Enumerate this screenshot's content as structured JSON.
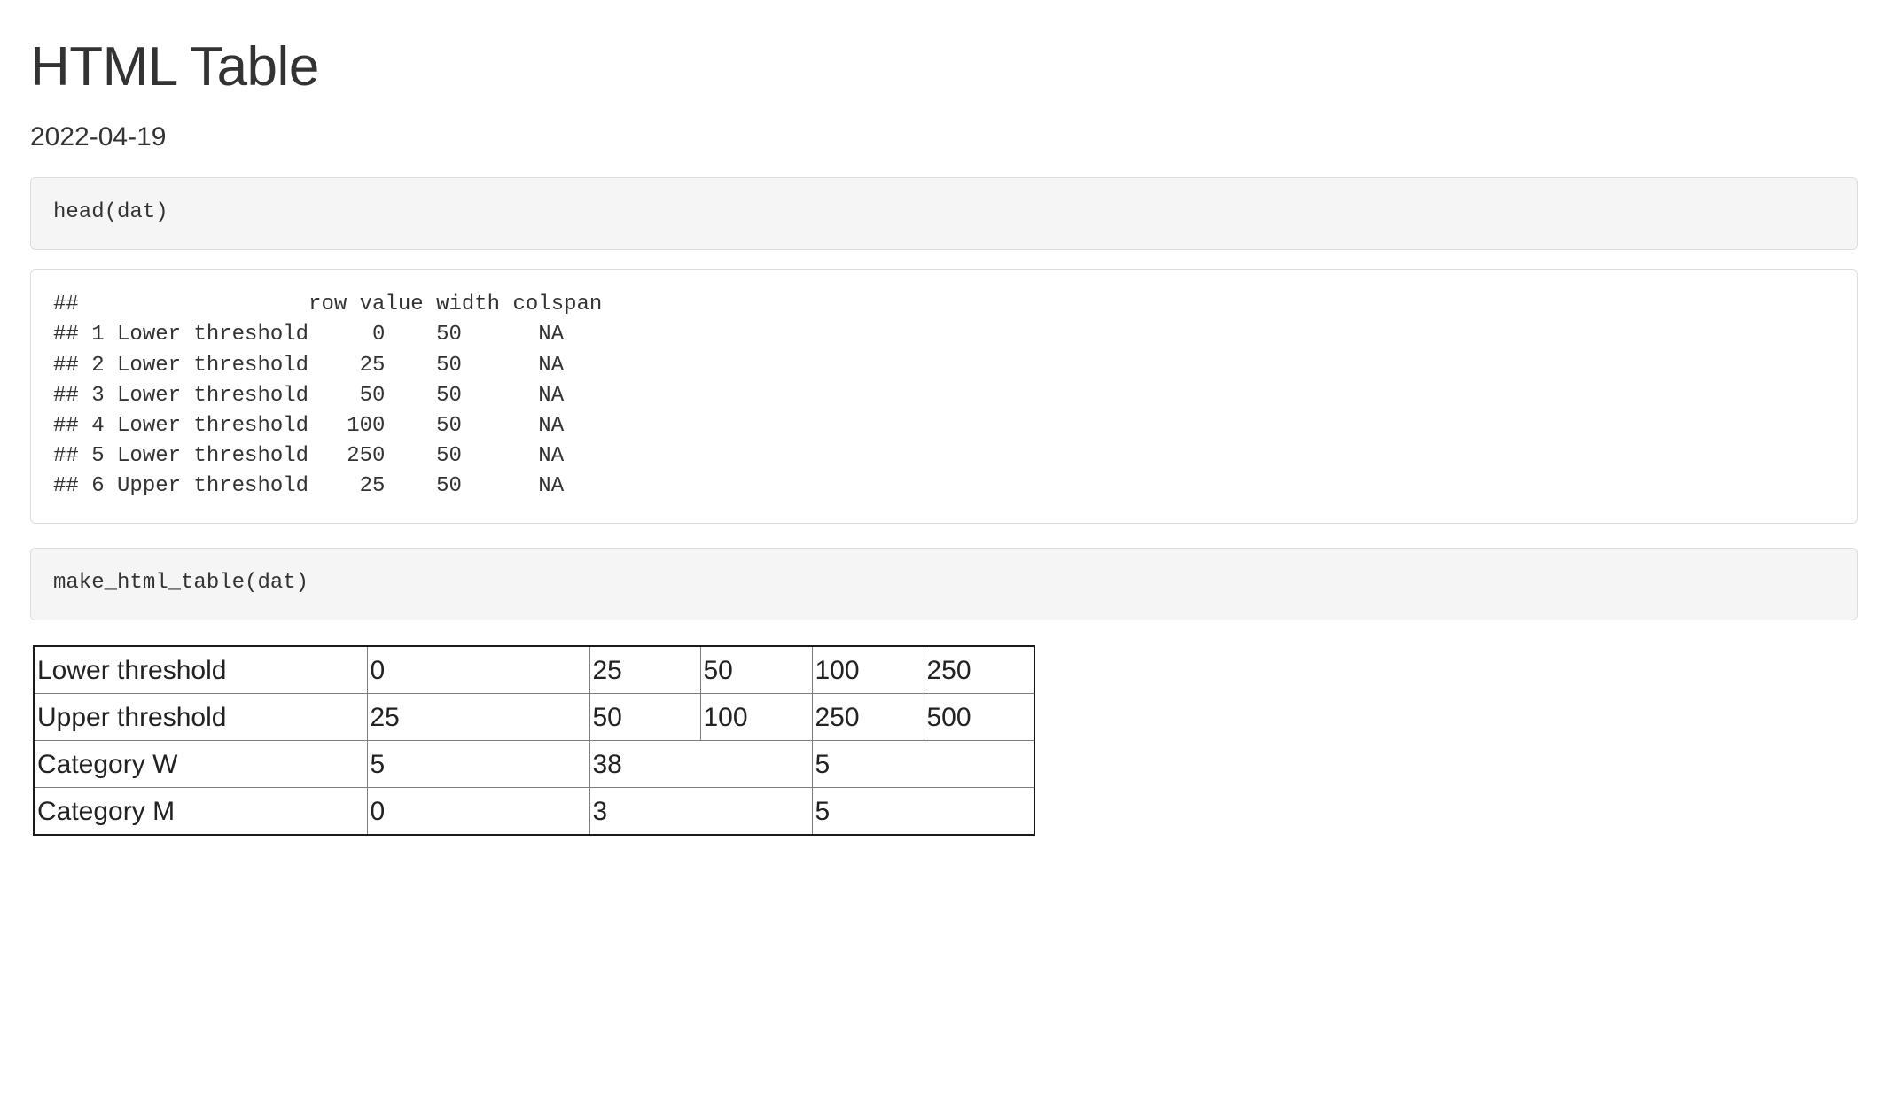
{
  "document": {
    "title": "HTML Table",
    "date": "2022-04-19"
  },
  "chunks": [
    {
      "kind": "source",
      "code": "head(dat)"
    },
    {
      "kind": "output",
      "text": "##                  row value width colspan\n## 1 Lower threshold     0    50      NA\n## 2 Lower threshold    25    50      NA\n## 3 Lower threshold    50    50      NA\n## 4 Lower threshold   100    50      NA\n## 5 Lower threshold   250    50      NA\n## 6 Upper threshold    25    50      NA"
    },
    {
      "kind": "source",
      "code": "make_html_table(dat)"
    }
  ],
  "source_chunk_1": "head(dat)",
  "output_chunk_1": "##                  row value width colspan\n## 1 Lower threshold     0    50      NA\n## 2 Lower threshold    25    50      NA\n## 3 Lower threshold    50    50      NA\n## 4 Lower threshold   100    50      NA\n## 5 Lower threshold   250    50      NA\n## 6 Upper threshold    25    50      NA",
  "source_chunk_2": "make_html_table(dat)",
  "dataframe": {
    "columns": [
      "",
      "row",
      "value",
      "width",
      "colspan"
    ],
    "rows": [
      [
        "1",
        "Lower threshold",
        "0",
        "50",
        "NA"
      ],
      [
        "2",
        "Lower threshold",
        "25",
        "50",
        "NA"
      ],
      [
        "3",
        "Lower threshold",
        "50",
        "50",
        "NA"
      ],
      [
        "4",
        "Lower threshold",
        "100",
        "50",
        "NA"
      ],
      [
        "5",
        "Lower threshold",
        "250",
        "50",
        "NA"
      ],
      [
        "6",
        "Upper threshold",
        "25",
        "50",
        "NA"
      ]
    ]
  },
  "rendered_table": {
    "rows": [
      {
        "label": "Lower threshold",
        "cells": [
          {
            "value": "0",
            "colspan": 1
          },
          {
            "value": "25",
            "colspan": 1
          },
          {
            "value": "50",
            "colspan": 1
          },
          {
            "value": "100",
            "colspan": 1
          },
          {
            "value": "250",
            "colspan": 1
          }
        ]
      },
      {
        "label": "Upper threshold",
        "cells": [
          {
            "value": "25",
            "colspan": 1
          },
          {
            "value": "50",
            "colspan": 1
          },
          {
            "value": "100",
            "colspan": 1
          },
          {
            "value": "250",
            "colspan": 1
          },
          {
            "value": "500",
            "colspan": 1
          }
        ]
      },
      {
        "label": "Category W",
        "cells": [
          {
            "value": "5",
            "colspan": 1
          },
          {
            "value": "38",
            "colspan": 2
          },
          {
            "value": "5",
            "colspan": 2
          }
        ]
      },
      {
        "label": "Category M",
        "cells": [
          {
            "value": "0",
            "colspan": 1
          },
          {
            "value": "3",
            "colspan": 2
          },
          {
            "value": "5",
            "colspan": 2
          }
        ]
      }
    ]
  },
  "colors": {
    "text": "#333333",
    "code_background": "#f5f5f5",
    "chunk_border": "#dddddd",
    "table_outer_border": "#1a1a1a",
    "table_inner_border": "#7d7d7d"
  }
}
